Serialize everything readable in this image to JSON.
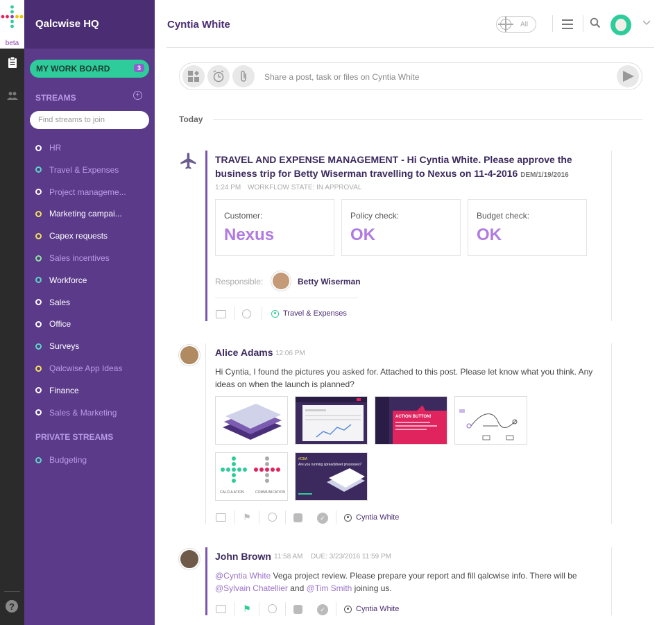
{
  "app": {
    "name": "Qalcwise HQ",
    "beta": "beta"
  },
  "sidebar": {
    "work_board": {
      "label": "MY WORK BOARD",
      "badge": "3"
    },
    "streams_heading": "STREAMS",
    "find_placeholder": "Find streams to join",
    "streams": [
      {
        "label": "HR",
        "dot": "#ffffff",
        "text_color": "#b99be6"
      },
      {
        "label": "Travel & Expenses",
        "dot": "#5dd6c9",
        "text_color": "#b99be6"
      },
      {
        "label": "Project manageme...",
        "dot": "#ffffff",
        "text_color": "#b99be6"
      },
      {
        "label": "Marketing campai...",
        "dot": "#f2e35b",
        "text_color": "#ffffff"
      },
      {
        "label": "Capex requests",
        "dot": "#f2e35b",
        "text_color": "#ffffff"
      },
      {
        "label": "Sales incentives",
        "dot": "#8fe3a1",
        "text_color": "#b99be6"
      },
      {
        "label": "Workforce",
        "dot": "#5dd6c9",
        "text_color": "#ffffff"
      },
      {
        "label": "Sales",
        "dot": "#ffffff",
        "text_color": "#ffffff"
      },
      {
        "label": "Office",
        "dot": "#ffffff",
        "text_color": "#ffffff"
      },
      {
        "label": "Surveys",
        "dot": "#5dd6c9",
        "text_color": "#ffffff"
      },
      {
        "label": "Qalcwise App Ideas",
        "dot": "#f2e35b",
        "text_color": "#b99be6"
      },
      {
        "label": "Finance",
        "dot": "#ffffff",
        "text_color": "#ffffff"
      },
      {
        "label": "Sales & Marketing",
        "dot": "#ffffff",
        "text_color": "#b99be6"
      }
    ],
    "private_heading": "PRIVATE STREAMS",
    "private_streams": [
      {
        "label": "Budgeting",
        "dot": "#5dd6c9",
        "text_color": "#b99be6"
      }
    ]
  },
  "header": {
    "title": "Cyntia White",
    "filter_label": "All"
  },
  "composer": {
    "placeholder": "Share a post, task or files on Cyntia White"
  },
  "feed": {
    "date_divider": "Today",
    "task": {
      "title": "TRAVEL AND EXPENSE MANAGEMENT - Hi Cyntia White. Please approve the business trip for Betty Wiserman travelling to Nexus on 11-4-2016",
      "code": "DEM/1/19/2016",
      "time": "1:24 PM",
      "workflow_state": "WORKFLOW STATE: IN APPROVAL",
      "cards": [
        {
          "label": "Customer:",
          "value": "Nexus"
        },
        {
          "label": "Policy check:",
          "value": "OK"
        },
        {
          "label": "Budget check:",
          "value": "OK"
        }
      ],
      "responsible_label": "Responsible:",
      "responsible_name": "Betty Wiserman",
      "stream_tag": "Travel & Expenses"
    },
    "post1": {
      "author": "Alice Adams",
      "time": "12:06 PM",
      "text": "Hi Cyntia, I found the pictures you asked for. Attached to this post. Please let know what you think. Any ideas on when the launch is planned?",
      "stream_tag": "Cyntia White",
      "thumb_texts": {
        "action": "ACTION BUTTON!",
        "calc": "CALCULATION",
        "comm": "COMMUNICATION",
        "spread_tag": "#CBA",
        "spread_q": "Are you running spreadsheet processes?"
      }
    },
    "post2": {
      "author": "John Brown",
      "time": "11:58 AM",
      "due": "DUE: 3/23/2016 11:59 PM",
      "mention1": "@Cyntia White",
      "text1": " Vega project review. Please prepare your report and fill qalcwise info. There will be",
      "mention2": "@Sylvain Chatellier",
      "text2": " and ",
      "mention3": "@Tim Smith",
      "text3": " joining us.",
      "stream_tag": "Cyntia White"
    }
  },
  "colors": {
    "accent": "#5b3a8a",
    "green": "#2ecc9a",
    "value": "#b17ae0"
  }
}
